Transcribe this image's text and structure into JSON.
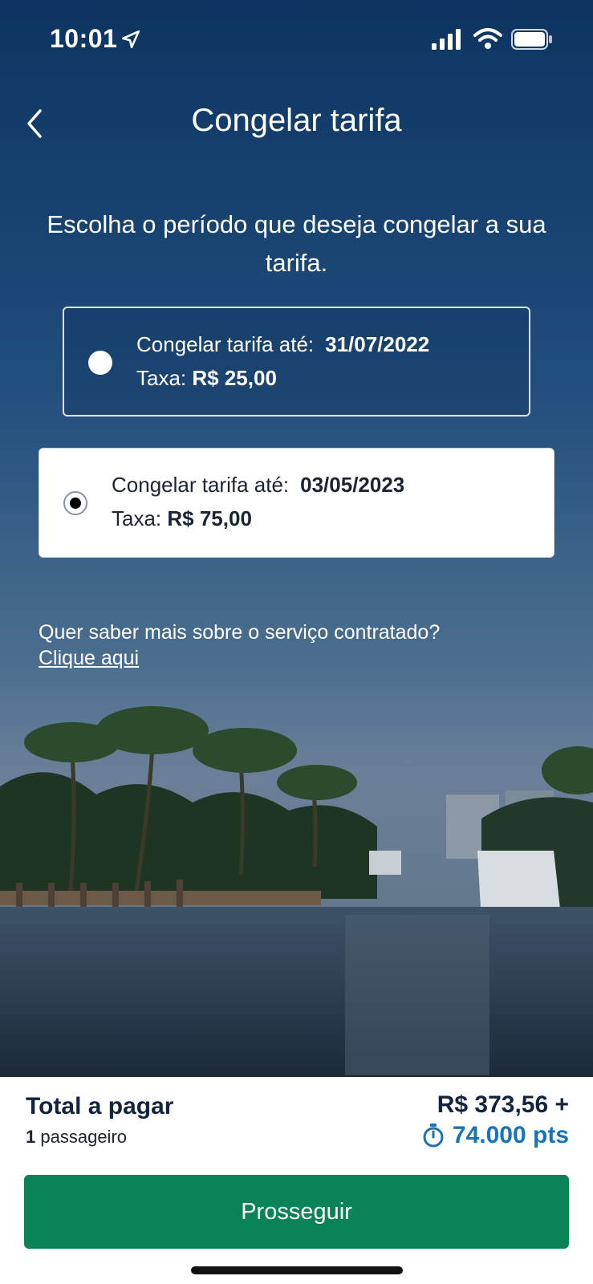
{
  "status_bar": {
    "time": "10:01"
  },
  "header": {
    "title": "Congelar tarifa"
  },
  "subtitle": "Escolha o período que deseja congelar a sua tarifa.",
  "options": [
    {
      "label": "Congelar tarifa até:",
      "date": "31/07/2022",
      "fee_label": "Taxa:",
      "fee": "R$ 25,00",
      "selected": false
    },
    {
      "label": "Congelar tarifa até:",
      "date": "03/05/2023",
      "fee_label": "Taxa:",
      "fee": "R$ 75,00",
      "selected": true
    }
  ],
  "info": {
    "question": "Quer saber mais sobre o serviço contratado?",
    "link": "Clique aqui"
  },
  "summary": {
    "total_label": "Total a pagar",
    "passenger_count": "1",
    "passenger_label": "passageiro",
    "price": "R$ 373,56 +",
    "points": "74.000 pts"
  },
  "cta": {
    "label": "Prosseguir"
  },
  "colors": {
    "accent_green": "#0a8356",
    "points_blue": "#1a73b5",
    "text_dark": "#12243f"
  }
}
